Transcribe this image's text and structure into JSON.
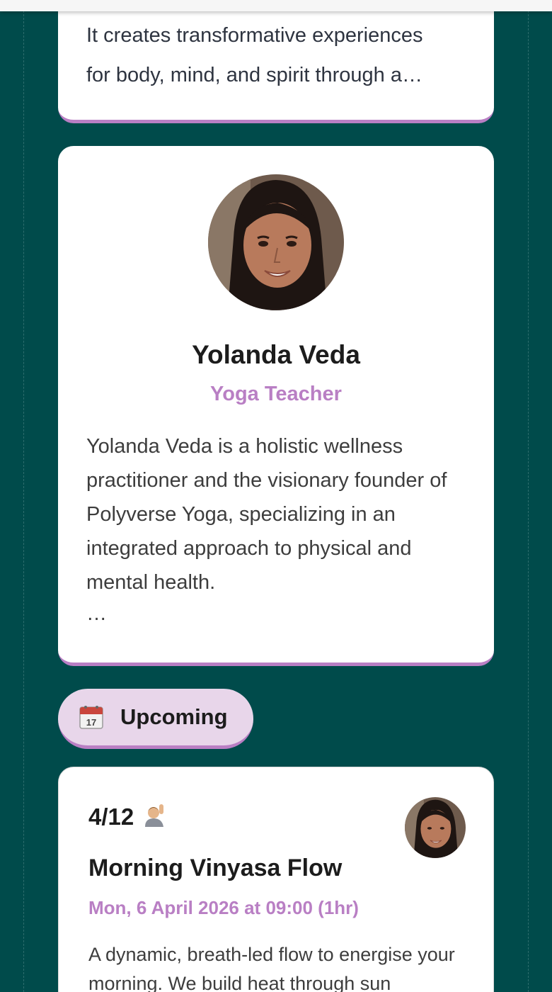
{
  "intro": {
    "text": "It creates transformative experiences\nfor body, mind, and spirit through a…"
  },
  "profile": {
    "name": "Yolanda Veda",
    "role": "Yoga Teacher",
    "bio": "Yolanda Veda is a holistic wellness practitioner and the visionary founder of Polyverse Yoga, specializing in an integrated approach to physical and mental health.",
    "ellipsis": "…",
    "avatar": "teacher-portrait"
  },
  "upcoming": {
    "icon": "calendar-icon",
    "label": "Upcoming"
  },
  "event": {
    "count": "4/12",
    "count_icon": "person-raising-hand-icon",
    "title": "Morning Vinyasa Flow",
    "datetime": "Mon, 6 April 2026 at 09:00 (1hr)",
    "description": "A dynamic, breath-led flow to energise your morning. We build heat through sun",
    "host_avatar": "teacher-portrait"
  },
  "colors": {
    "background": "#004b4b",
    "accent": "#b97fc4",
    "pill": "#e8d6ea"
  }
}
